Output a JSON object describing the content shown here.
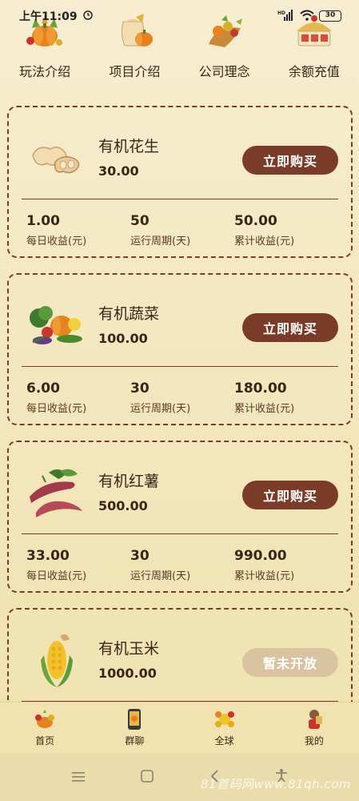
{
  "status": {
    "time": "上午11:09",
    "battery": "30",
    "signal": "HD"
  },
  "topnav": [
    {
      "label": "玩法介绍",
      "icon": "pumpkin-basket-icon"
    },
    {
      "label": "项目介绍",
      "icon": "grain-sack-icon"
    },
    {
      "label": "公司理念",
      "icon": "harvest-cornucopia-icon"
    },
    {
      "label": "余额充值",
      "icon": "gift-basket-icon"
    }
  ],
  "products": [
    {
      "name": "有机花生",
      "price": "30.00",
      "button": "立即购买",
      "daily": "1.00",
      "period": "50",
      "total": "50.00",
      "icon": "peanut-icon"
    },
    {
      "name": "有机蔬菜",
      "price": "100.00",
      "button": "立即购买",
      "daily": "6.00",
      "period": "30",
      "total": "180.00",
      "icon": "vegetables-icon"
    },
    {
      "name": "有机红薯",
      "price": "500.00",
      "button": "立即购买",
      "daily": "33.00",
      "period": "30",
      "total": "990.00",
      "icon": "sweet-potato-icon"
    },
    {
      "name": "有机玉米",
      "price": "1000.00",
      "button": "暂未开放",
      "icon": "corn-icon"
    }
  ],
  "stat_labels": {
    "daily": "每日收益(元)",
    "period": "运行周期(天)",
    "total": "累计收益(元)"
  },
  "tabs": [
    {
      "label": "首页",
      "icon": "home-harvest-icon"
    },
    {
      "label": "群聊",
      "icon": "group-chat-icon"
    },
    {
      "label": "全球",
      "icon": "globe-flowers-icon"
    },
    {
      "label": "我的",
      "icon": "profile-icon"
    }
  ],
  "watermark": "81首码网www.81qh.com"
}
